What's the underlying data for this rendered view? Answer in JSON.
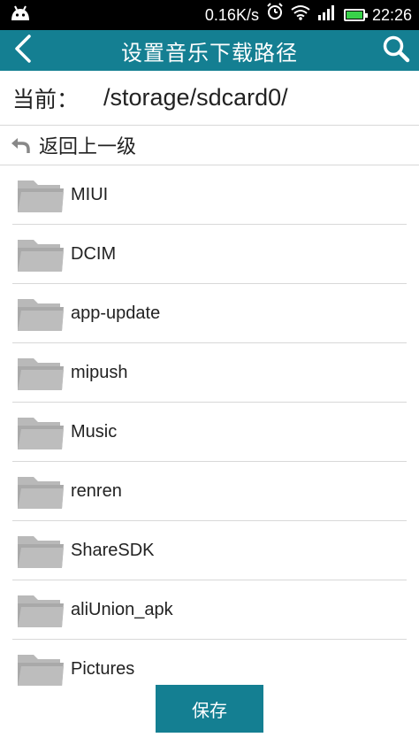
{
  "status_bar": {
    "network_speed": "0.16K/s",
    "time": "22:26",
    "icons": [
      "android-icon",
      "alarm-icon",
      "wifi-icon",
      "signal-icon",
      "battery-icon"
    ]
  },
  "header": {
    "title": "设置音乐下载路径",
    "back_icon": "back-chevron-icon",
    "search_icon": "search-icon",
    "background_color": "#147f92"
  },
  "current_path": {
    "label": "当前：",
    "value": "/storage/sdcard0/"
  },
  "go_up": {
    "label": "返回上一级",
    "icon": "undo-arrow-icon"
  },
  "folders": [
    {
      "name": "MIUI"
    },
    {
      "name": "DCIM"
    },
    {
      "name": "app-update"
    },
    {
      "name": "mipush"
    },
    {
      "name": "Music"
    },
    {
      "name": "renren"
    },
    {
      "name": "ShareSDK"
    },
    {
      "name": "aliUnion_apk"
    },
    {
      "name": "Pictures"
    }
  ],
  "save_button": {
    "label": "保存",
    "color": "#147f92"
  }
}
